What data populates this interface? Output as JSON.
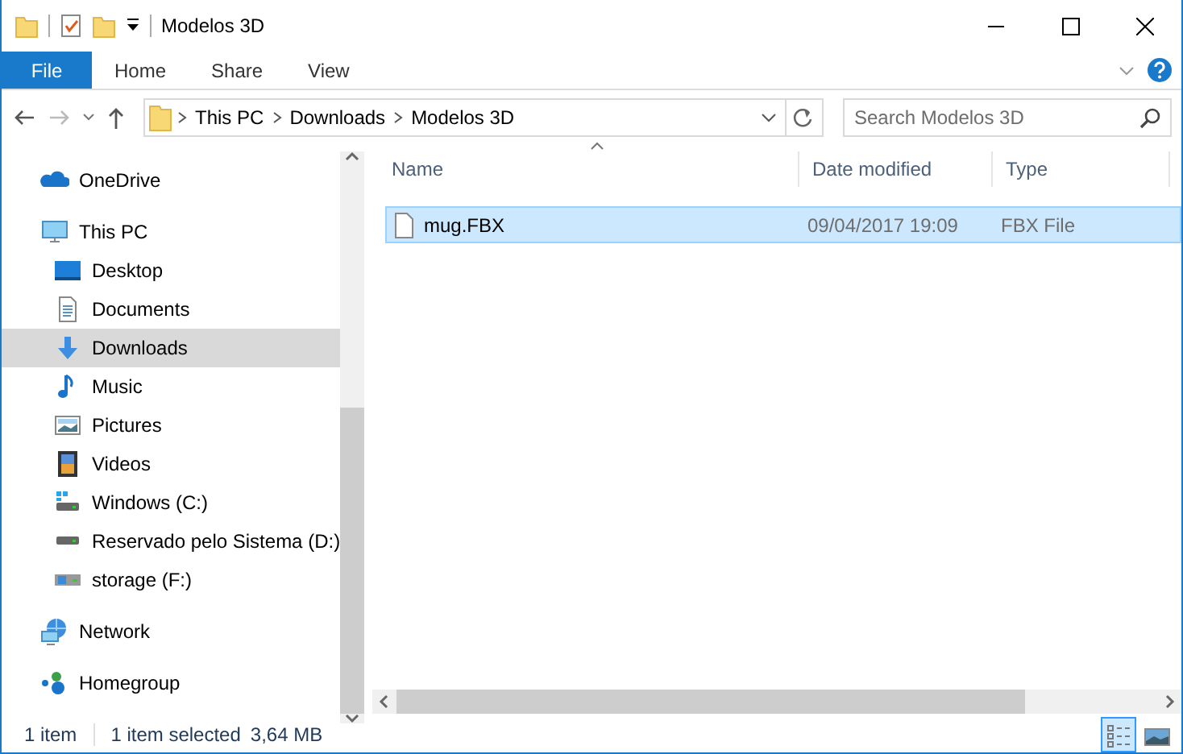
{
  "window": {
    "title": "Modelos 3D"
  },
  "ribbon": {
    "tabs": [
      {
        "label": "File",
        "kind": "file"
      },
      {
        "label": "Home",
        "kind": "tab"
      },
      {
        "label": "Share",
        "kind": "tab"
      },
      {
        "label": "View",
        "kind": "tab"
      }
    ]
  },
  "address": {
    "crumbs": [
      "This PC",
      "Downloads",
      "Modelos 3D"
    ],
    "search_placeholder": "Search Modelos 3D"
  },
  "sidebar": {
    "items": [
      {
        "label": "OneDrive",
        "selected": false
      },
      {
        "label": "This PC",
        "selected": false,
        "children": [
          {
            "label": "Desktop",
            "selected": false
          },
          {
            "label": "Documents",
            "selected": false
          },
          {
            "label": "Downloads",
            "selected": true
          },
          {
            "label": "Music",
            "selected": false
          },
          {
            "label": "Pictures",
            "selected": false
          },
          {
            "label": "Videos",
            "selected": false
          },
          {
            "label": "Windows (C:)",
            "selected": false
          },
          {
            "label": "Reservado pelo Sistema (D:)",
            "selected": false
          },
          {
            "label": "storage (F:)",
            "selected": false
          }
        ]
      },
      {
        "label": "Network",
        "selected": false
      },
      {
        "label": "Homegroup",
        "selected": false
      }
    ]
  },
  "table": {
    "columns": [
      {
        "label": "Name",
        "sorted": true
      },
      {
        "label": "Date modified",
        "sorted": false
      },
      {
        "label": "Type",
        "sorted": false
      }
    ],
    "rows": [
      {
        "name": "mug.FBX",
        "date": "09/04/2017 19:09",
        "type": "FBX File",
        "selected": true
      }
    ]
  },
  "status_bar": {
    "count": "1 item",
    "selection": "1 item selected",
    "size": "3,64 MB"
  },
  "view_buttons": [
    {
      "selected": true
    },
    {
      "selected": false
    }
  ]
}
